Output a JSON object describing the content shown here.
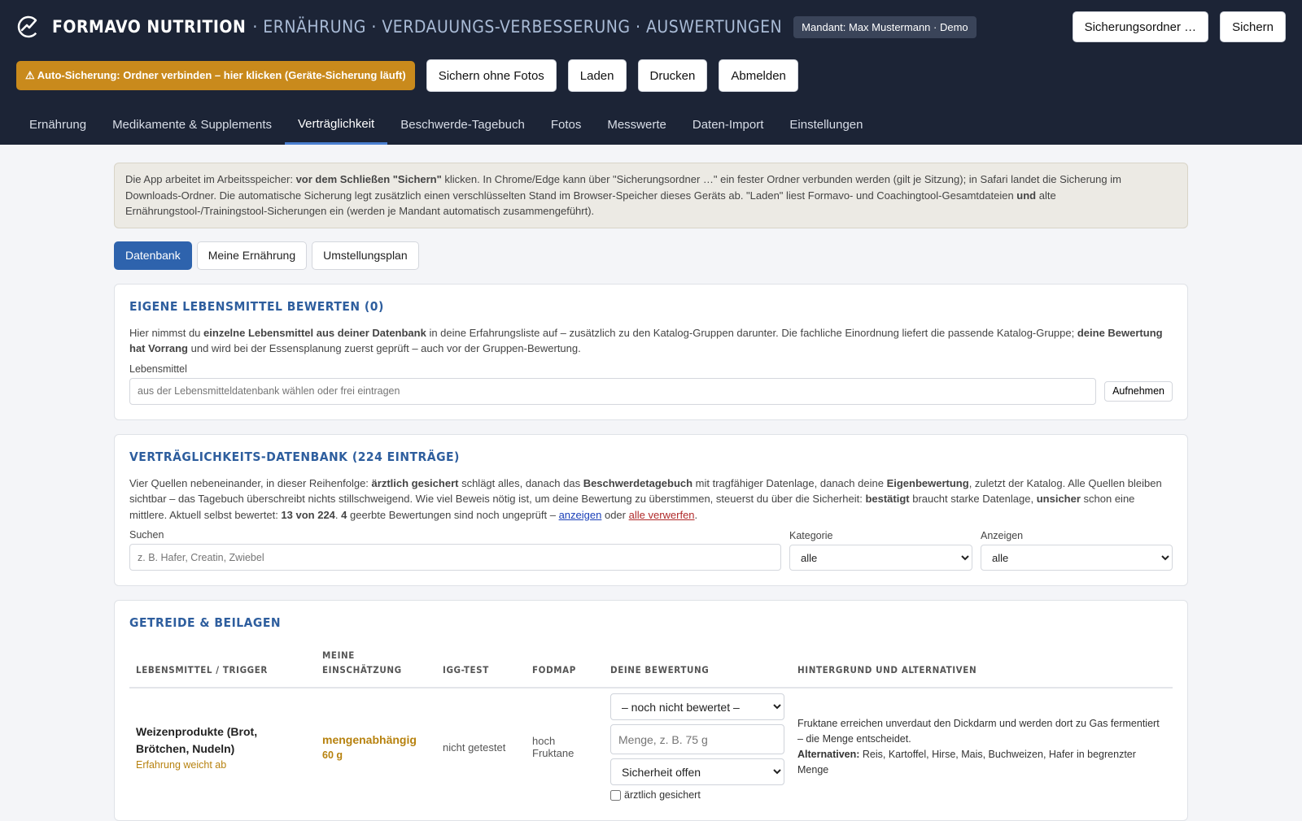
{
  "header": {
    "brand": "FORMAVO NUTRITION",
    "subtitle": "· ERNÄHRUNG · VERDAUUNGS-VERBESSERUNG · AUSWERTUNGEN",
    "mandant": "Mandant: Max Mustermann · Demo",
    "btn_backup_folder": "Sicherungsordner …",
    "btn_save": "Sichern",
    "auto_backup": "⚠ Auto-Sicherung: Ordner verbinden – hier klicken (Geräte-Sicherung läuft)",
    "btn_save_no_photos": "Sichern ohne Fotos",
    "btn_load": "Laden",
    "btn_print": "Drucken",
    "btn_logout": "Abmelden"
  },
  "tabs": [
    {
      "label": "Ernährung"
    },
    {
      "label": "Medikamente & Supplements"
    },
    {
      "label": "Verträglichkeit"
    },
    {
      "label": "Beschwerde-Tagebuch"
    },
    {
      "label": "Fotos"
    },
    {
      "label": "Messwerte"
    },
    {
      "label": "Daten-Import"
    },
    {
      "label": "Einstellungen"
    }
  ],
  "info": {
    "t1": "Die App arbeitet im Arbeitsspeicher: ",
    "b1": "vor dem Schließen \"Sichern\"",
    "t2": " klicken. In Chrome/Edge kann über \"Sicherungsordner …\" ein fester Ordner verbunden werden (gilt je Sitzung); in Safari landet die Sicherung im Downloads-Ordner. Die automatische Sicherung legt zusätzlich einen verschlüsselten Stand im Browser-Speicher dieses Geräts ab. \"Laden\" liest Formavo- und Coachingtool-Gesamtdateien ",
    "b2": "und",
    "t3": " alte Ernährungstool-/Trainingstool-Sicherungen ein (werden je Mandant automatisch zusammengeführt)."
  },
  "subtabs": [
    {
      "label": "Datenbank"
    },
    {
      "label": "Meine Ernährung"
    },
    {
      "label": "Umstellungsplan"
    }
  ],
  "own": {
    "title": "Eigene Lebensmittel bewerten (0)",
    "t1": "Hier nimmst du ",
    "b1": "einzelne Lebensmittel aus deiner Datenbank",
    "t2": " in deine Erfahrungsliste auf – zusätzlich zu den Katalog-Gruppen darunter. Die fachliche Einordnung liefert die passende Katalog-Gruppe; ",
    "b2": "deine Bewertung hat Vorrang",
    "t3": " und wird bei der Essensplanung zuerst geprüft – auch vor der Gruppen-Bewertung.",
    "label": "Lebensmittel",
    "placeholder": "aus der Lebensmitteldatenbank wählen oder frei eintragen",
    "btn": "Aufnehmen"
  },
  "db": {
    "title": "Verträglichkeits-Datenbank (224 Einträge)",
    "t1": "Vier Quellen nebeneinander, in dieser Reihenfolge: ",
    "b1": "ärztlich gesichert",
    "t2": " schlägt alles, danach das ",
    "b2": "Beschwerdetagebuch",
    "t3": " mit tragfähiger Datenlage, danach deine ",
    "b3": "Eigenbewertung",
    "t4": ", zuletzt der Katalog. Alle Quellen bleiben sichtbar – das Tagebuch überschreibt nichts stillschweigend. Wie viel Beweis nötig ist, um deine Bewertung zu überstimmen, steuerst du über die Sicherheit: ",
    "b4": "bestätigt",
    "t5": " braucht starke Datenlage, ",
    "b5": "unsicher",
    "t6": " schon eine mittlere. Aktuell selbst bewertet: ",
    "b6": "13 von 224",
    "t7": ". ",
    "b7": "4",
    "t8": " geerbte Bewertungen sind noch ungeprüft – ",
    "link1": "anzeigen",
    "t9": " oder ",
    "link2": "alle verwerfen",
    "t10": ".",
    "search_label": "Suchen",
    "search_placeholder": "z. B. Hafer, Creatin, Zwiebel",
    "cat_label": "Kategorie",
    "cat_value": "alle",
    "show_label": "Anzeigen",
    "show_value": "alle"
  },
  "group": {
    "title": "Getreide & Beilagen",
    "headers": [
      "Lebensmittel / Trigger",
      "Meine Einschätzung",
      "IgG-Test",
      "FODMAP",
      "Deine Bewertung",
      "Hintergrund und Alternativen"
    ],
    "row": {
      "name": "Weizenprodukte (Brot, Brötchen, Nudeln)",
      "note": "Erfahrung weicht ab",
      "assess": "mengenabhängig",
      "assess_amt": "60 g",
      "igg": "nicht getestet",
      "fodmap1": "hoch",
      "fodmap2": "Fruktane",
      "bew_select": "– noch nicht bewertet –",
      "bew_amount_placeholder": "Menge, z. B. 75 g",
      "bew_safety": "Sicherheit offen",
      "bew_check": "ärztlich gesichert",
      "bg1": "Fruktane erreichen unverdaut den Dickdarm und werden dort zu Gas fermentiert – die Menge entscheidet.",
      "bg_alt_label": "Alternativen:",
      "bg_alt": " Reis, Kartoffel, Hirse, Mais, Buchweizen, Hafer in begrenzter Menge"
    }
  }
}
